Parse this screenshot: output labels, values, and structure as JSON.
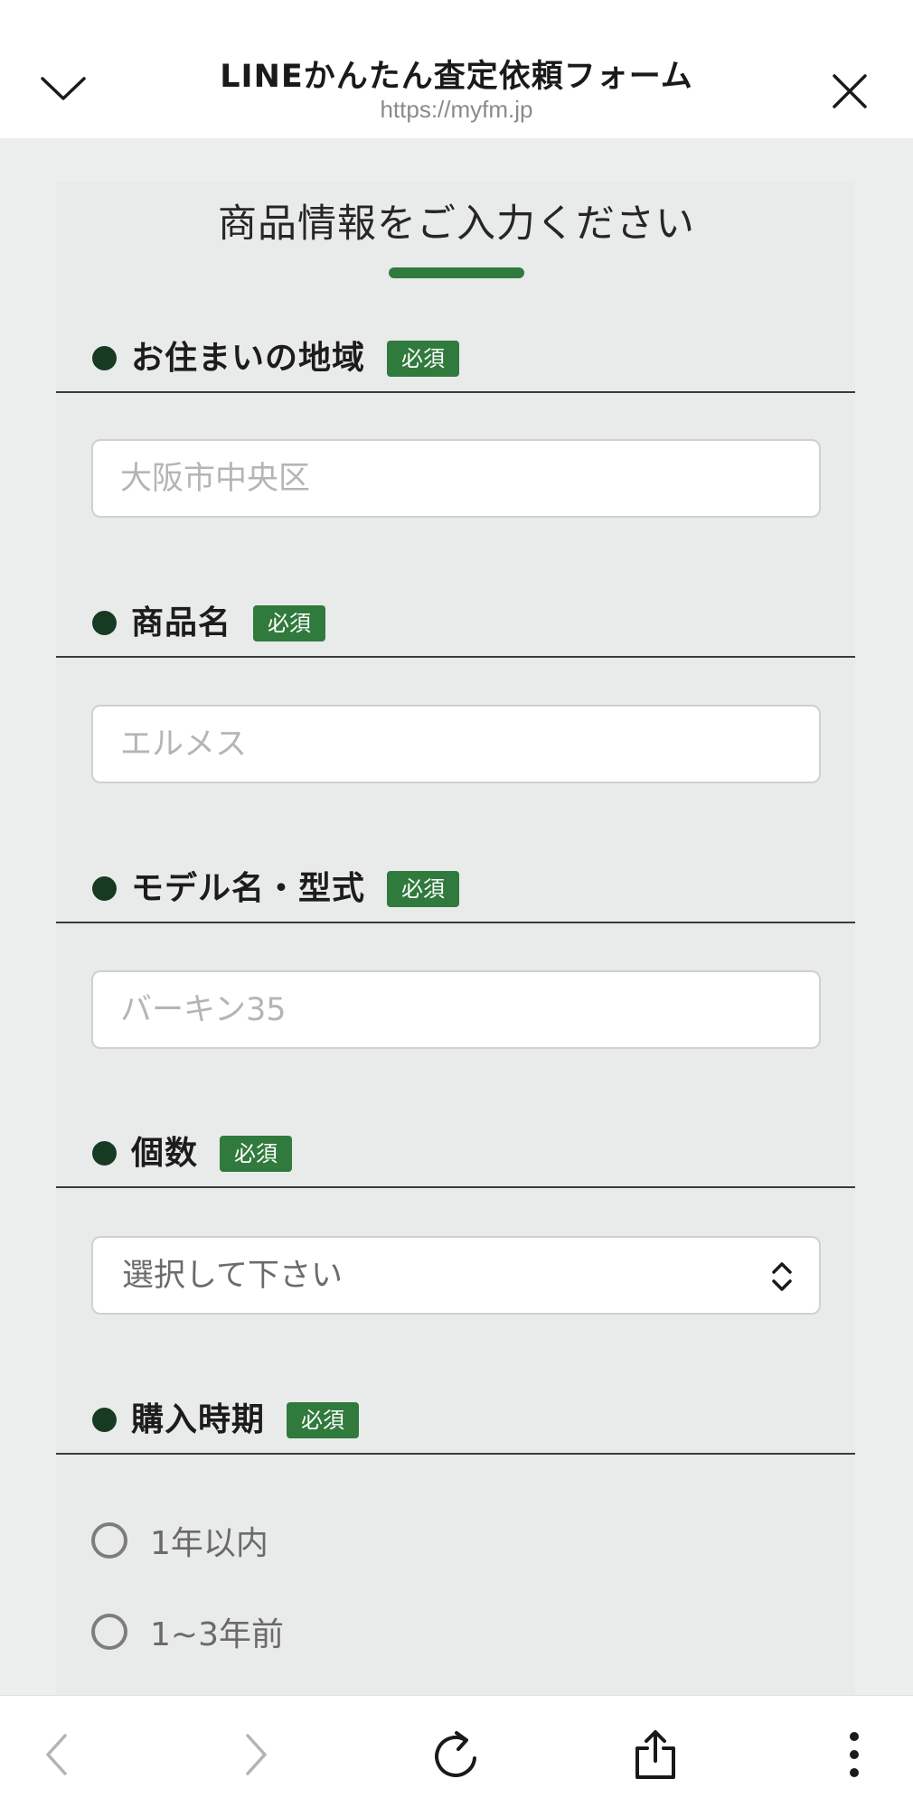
{
  "header": {
    "title": "LINEかんたん査定依頼フォーム",
    "url": "https://myfm.jp",
    "collapse_icon": "chevron-down-icon",
    "close_icon": "close-icon"
  },
  "form": {
    "heading": "商品情報をご入力ください",
    "accent_color": "#2f7a3c",
    "required_label": "必須",
    "sections": {
      "region": {
        "label": "お住まいの地域",
        "placeholder": "大阪市中央区"
      },
      "product": {
        "label": "商品名",
        "placeholder": "エルメス"
      },
      "model": {
        "label": "モデル名・型式",
        "placeholder": "バーキン35"
      },
      "quantity": {
        "label": "個数",
        "selected": "選択して下さい",
        "icon": "chevron-updown-icon"
      },
      "purchase_period": {
        "label": "購入時期",
        "options": [
          "1年以内",
          "1~3年前"
        ]
      }
    }
  },
  "browser_toolbar": {
    "icons": [
      "back-icon",
      "forward-icon",
      "reload-icon",
      "share-icon",
      "more-icon"
    ]
  }
}
